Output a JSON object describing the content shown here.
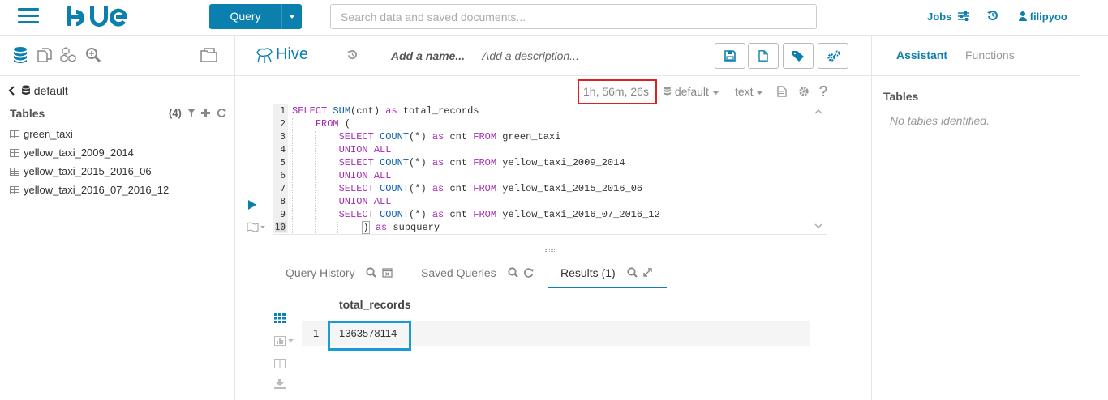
{
  "topbar": {
    "logo_text": "HUE",
    "query_button": "Query",
    "search_placeholder": "Search data and saved documents...",
    "jobs_label": "Jobs",
    "username": "filipyoo"
  },
  "left": {
    "database": "default",
    "tables_label": "Tables",
    "tables_count": "(4)",
    "tables": [
      "green_taxi",
      "yellow_taxi_2009_2014",
      "yellow_taxi_2015_2016_06",
      "yellow_taxi_2016_07_2016_12"
    ]
  },
  "editor_header": {
    "engine": "Hive",
    "name_placeholder": "Add a name...",
    "description_placeholder": "Add a description..."
  },
  "toolbar": {
    "elapsed": "1h, 56m, 26s",
    "database": "default",
    "format": "text"
  },
  "code": {
    "line_numbers": [
      "1",
      "2",
      "3",
      "4",
      "5",
      "6",
      "7",
      "8",
      "9",
      "10"
    ]
  },
  "result_tabs": {
    "history": "Query History",
    "saved": "Saved Queries",
    "results": "Results (1)"
  },
  "results": {
    "column": "total_records",
    "rows": [
      {
        "num": "1",
        "value": "1363578114"
      }
    ]
  },
  "right": {
    "tab_assistant": "Assistant",
    "tab_functions": "Functions",
    "tables_label": "Tables",
    "empty_text": "No tables identified."
  },
  "colors": {
    "accent": "#0b7fad",
    "highlight_red": "#e02020",
    "highlight_blue": "#1a9ad6"
  }
}
